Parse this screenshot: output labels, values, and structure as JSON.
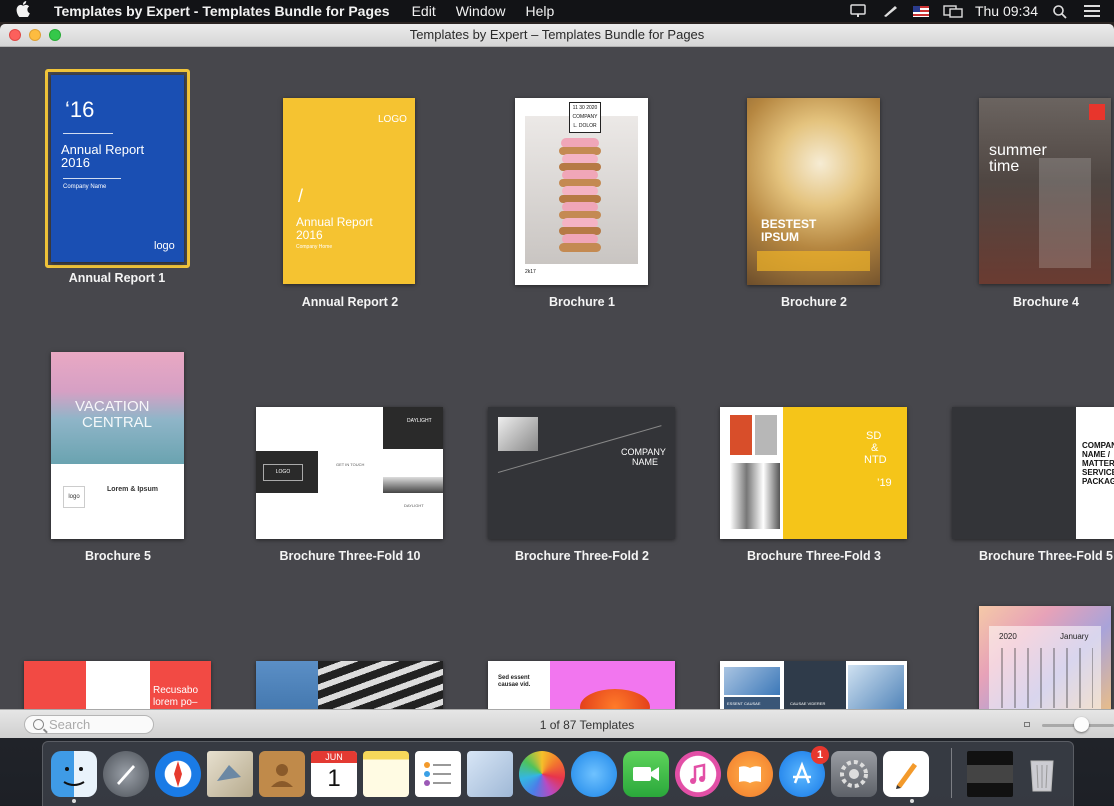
{
  "menubar": {
    "app_name": "Templates by Expert - Templates Bundle for Pages",
    "menus": [
      "Edit",
      "Window",
      "Help"
    ],
    "clock": "Thu 09:34"
  },
  "window": {
    "title": "Templates by Expert – Templates Bundle for Pages"
  },
  "templates": [
    {
      "name": "Annual Report 1",
      "selected": true
    },
    {
      "name": "Annual Report 2"
    },
    {
      "name": "Brochure 1"
    },
    {
      "name": "Brochure 2"
    },
    {
      "name": "Brochure 4"
    },
    {
      "name": "Brochure 5"
    },
    {
      "name": "Brochure Three-Fold 10"
    },
    {
      "name": "Brochure Three-Fold 2"
    },
    {
      "name": "Brochure Three-Fold 3"
    },
    {
      "name": "Brochure Three-Fold 5"
    }
  ],
  "thumb_text": {
    "ar1_year": "‘16",
    "ar1_title": "Annual Report",
    "ar1_year2": "2016",
    "ar1_company": "Company Name",
    "ar1_logo": "logo",
    "ar2_logo": "LOGO",
    "ar2_slash": "/",
    "ar2_title": "Annual Report",
    "ar2_year": "2016",
    "ar2_company": "Company Home",
    "b1_date": "11 30 2020",
    "b1_company": "COMPANY",
    "b1_dolor": "L. DOLOR",
    "b1_year": "2k17",
    "b2_title1": "BESTEST",
    "b2_title2": "IPSUM",
    "b4_title1": "summer",
    "b4_title2": "time",
    "b5_vacation": "VACATION",
    "b5_central": "CENTRAL",
    "b5_logo": "logo",
    "b5_heading": "Lorem & Ipsum",
    "tf10_daylight": "DAYLIGHT",
    "tf10_logo": "LOGO",
    "tf10_touch": "GET IN TOUCH",
    "tf10_daylight2": "DAYLIGHT",
    "tf2_company": "COMPANY",
    "tf2_name": "NAME",
    "tf3_sd": "SD",
    "tf3_amp": "&",
    "tf3_ntd": "NTD",
    "tf3_year": "’19",
    "tf5_company": "COMPANY",
    "tf5_name": "NAME /",
    "tf5_matter": "MATTER",
    "tf5_service": "SERVICE",
    "tf5_package": "PACKAGE",
    "r3a_title": "Recusabo",
    "r3a_title2": "lorem po–",
    "r3c_line1": "Sed essent",
    "r3c_line2": "causae vid.",
    "r3d_essent": "ESSENT CAUSAE",
    "r3d_videre": "VIDERER AN.",
    "r3d_causae": "CAUSAE VIDERER",
    "r3d_lorem": "LOREM AN.",
    "cal_year": "2020",
    "cal_month": "January"
  },
  "bottombar": {
    "search_placeholder": "Search",
    "count": "1 of 87 Templates",
    "zoom_level": 0.55
  },
  "dock": {
    "calendar_month": "JUN",
    "calendar_day": "1",
    "appstore_badge": "1",
    "items": [
      "finder",
      "launchpad",
      "safari",
      "mail",
      "contacts",
      "calendar",
      "notes",
      "reminders",
      "preview",
      "photos",
      "messages",
      "facetime",
      "itunes",
      "ibooks",
      "app-store",
      "system-preferences",
      "pages",
      "screenshot-stack",
      "trash"
    ]
  }
}
